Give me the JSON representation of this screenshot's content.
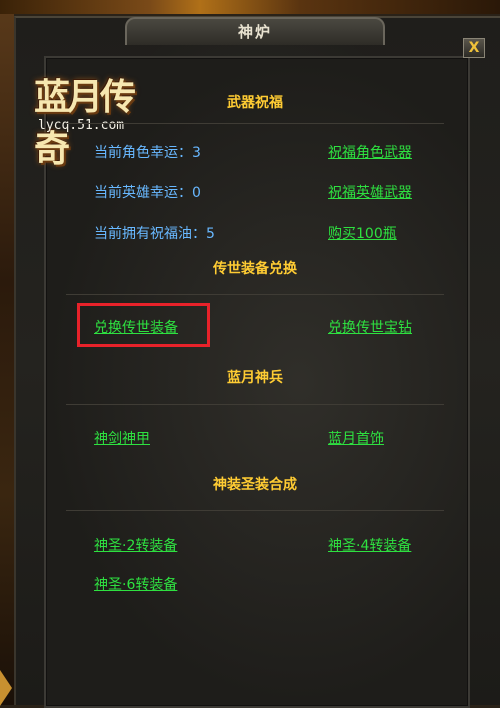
{
  "window": {
    "title": "神炉",
    "close_label": "X"
  },
  "logo": {
    "name": "蓝月传奇",
    "url": "lycq.51.com"
  },
  "weapon_bless": {
    "title": "武器祝福",
    "role_luck_label": "当前角色幸运：3",
    "hero_luck_label": "当前英雄幸运：0",
    "oil_label": "当前拥有祝福油：5",
    "bless_role_weapon": "祝福角色武器",
    "bless_hero_weapon": "祝福英雄武器",
    "buy_oil": "购买100瓶"
  },
  "legend_exchange": {
    "title": "传世装备兑换",
    "exchange_equipment": "兑换传世装备",
    "exchange_diamond": "兑换传世宝钻"
  },
  "blue_moon_weapons": {
    "title": "蓝月神兵",
    "divine_sword_armor": "神剑神甲",
    "blue_moon_jewelry": "蓝月首饰"
  },
  "synthesis": {
    "title": "神装圣装合成",
    "holy_2": "神圣·2转装备",
    "holy_4": "神圣·4转装备",
    "holy_6": "神圣·6转装备"
  },
  "colors": {
    "section_title": "#ffcc33",
    "stat_text": "#68b8ff",
    "link": "#2ee040",
    "highlight": "#e8222a"
  }
}
